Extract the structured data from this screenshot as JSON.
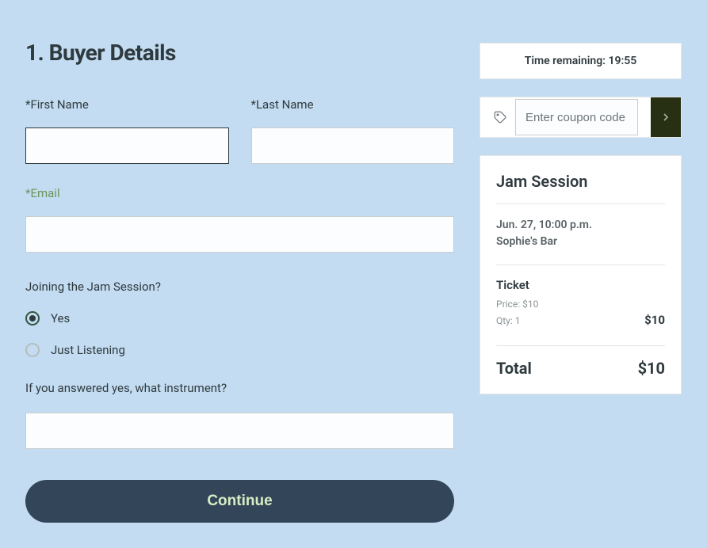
{
  "heading": "1.  Buyer Details",
  "fields": {
    "first_name_label": "*First Name",
    "last_name_label": "*Last Name",
    "email_label": "*Email",
    "first_name": "",
    "last_name": "",
    "email": ""
  },
  "question1": {
    "label": "Joining the Jam Session?",
    "options": {
      "yes": "Yes",
      "listening": "Just Listening"
    },
    "selected": "yes"
  },
  "question2": {
    "label": "If you answered yes, what instrument?",
    "value": ""
  },
  "continue_label": "Continue",
  "timer": {
    "prefix": "Time remaining: ",
    "value": "19:55"
  },
  "coupon": {
    "placeholder": "Enter coupon code"
  },
  "summary": {
    "title": "Jam Session",
    "datetime": "Jun. 27, 10:00 p.m.",
    "venue": "Sophie's Bar",
    "ticket": {
      "name": "Ticket",
      "price_label": "Price: $10",
      "qty_label": "Qty: 1",
      "line_total": "$10"
    },
    "total_label": "Total",
    "total": "$10"
  }
}
